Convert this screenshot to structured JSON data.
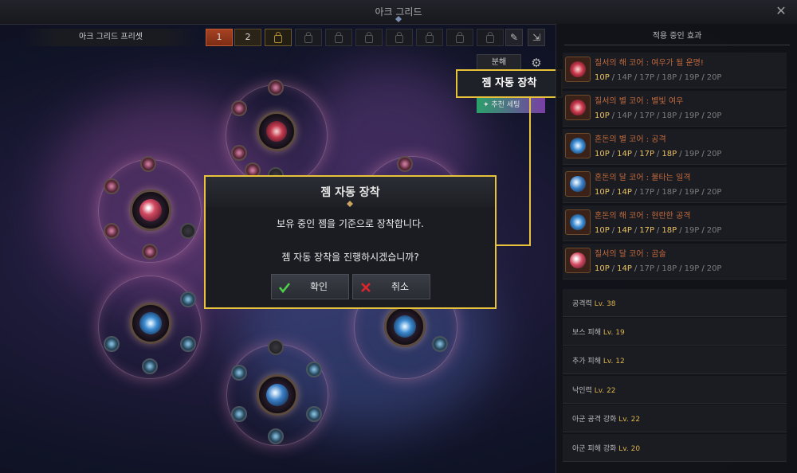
{
  "window": {
    "title": "아크 그리드"
  },
  "preset_bar": {
    "label": "아크 그리드 프리셋",
    "slots": [
      {
        "label": "1",
        "state": "active"
      },
      {
        "label": "2",
        "state": "available"
      },
      {
        "label": "",
        "state": "locked-gold"
      },
      {
        "label": "",
        "state": "locked"
      },
      {
        "label": "",
        "state": "locked"
      },
      {
        "label": "",
        "state": "locked"
      },
      {
        "label": "",
        "state": "locked"
      },
      {
        "label": "",
        "state": "locked"
      },
      {
        "label": "",
        "state": "locked"
      },
      {
        "label": "",
        "state": "locked"
      }
    ],
    "tools": [
      {
        "icon": "edit-icon"
      },
      {
        "icon": "export-icon"
      }
    ]
  },
  "grid_controls": {
    "disassemble_label": "분해",
    "recommend_label": "추천 세팅",
    "callout_label": "젬 자동 장착"
  },
  "dialog": {
    "title": "젬 자동 장착",
    "message1": "보유 중인 젬을 기준으로 장착합니다.",
    "message2": "젬 자동 장착을 진행하시겠습니까?",
    "confirm_label": "확인",
    "cancel_label": "취소"
  },
  "right_panel": {
    "title": "적용 중인 효과",
    "effects": [
      {
        "name": "질서의 해 코어 : 여우가 될 운명!",
        "gem": "red",
        "points": [
          "10P",
          "14P",
          "17P",
          "18P",
          "19P",
          "20P"
        ],
        "active_count": 1
      },
      {
        "name": "질서의 별 코어 : 별빛 여우",
        "gem": "red",
        "points": [
          "10P",
          "14P",
          "17P",
          "18P",
          "19P",
          "20P"
        ],
        "active_count": 1
      },
      {
        "name": "혼돈의 별 코어 : 공격",
        "gem": "blue",
        "points": [
          "10P",
          "14P",
          "17P",
          "18P",
          "19P",
          "20P"
        ],
        "active_count": 4
      },
      {
        "name": "혼돈의 달 코어 : 불타는 일격",
        "gem": "blue",
        "points": [
          "10P",
          "14P",
          "17P",
          "18P",
          "19P",
          "20P"
        ],
        "active_count": 2
      },
      {
        "name": "혼돈의 해 코어 : 현란한 공격",
        "gem": "blue",
        "points": [
          "10P",
          "14P",
          "17P",
          "18P",
          "19P",
          "20P"
        ],
        "active_count": 4
      },
      {
        "name": "질서의 달 코어 : 곰술",
        "gem": "red",
        "points": [
          "10P",
          "14P",
          "17P",
          "18P",
          "19P",
          "20P"
        ],
        "active_count": 2
      }
    ],
    "stats": [
      {
        "name": "공격력",
        "level": "Lv. 38"
      },
      {
        "name": "보스 피해",
        "level": "Lv. 19"
      },
      {
        "name": "추가 피해",
        "level": "Lv. 12"
      },
      {
        "name": "낙인력",
        "level": "Lv. 22"
      },
      {
        "name": "아군 공격 강화",
        "level": "Lv. 22"
      },
      {
        "name": "아군 피해 강화",
        "level": "Lv. 20"
      }
    ]
  },
  "colors": {
    "accent_gold": "#e8c23a",
    "point_active": "#e7c060",
    "effect_name": "#c26a3c",
    "active_preset": "#a64222"
  }
}
